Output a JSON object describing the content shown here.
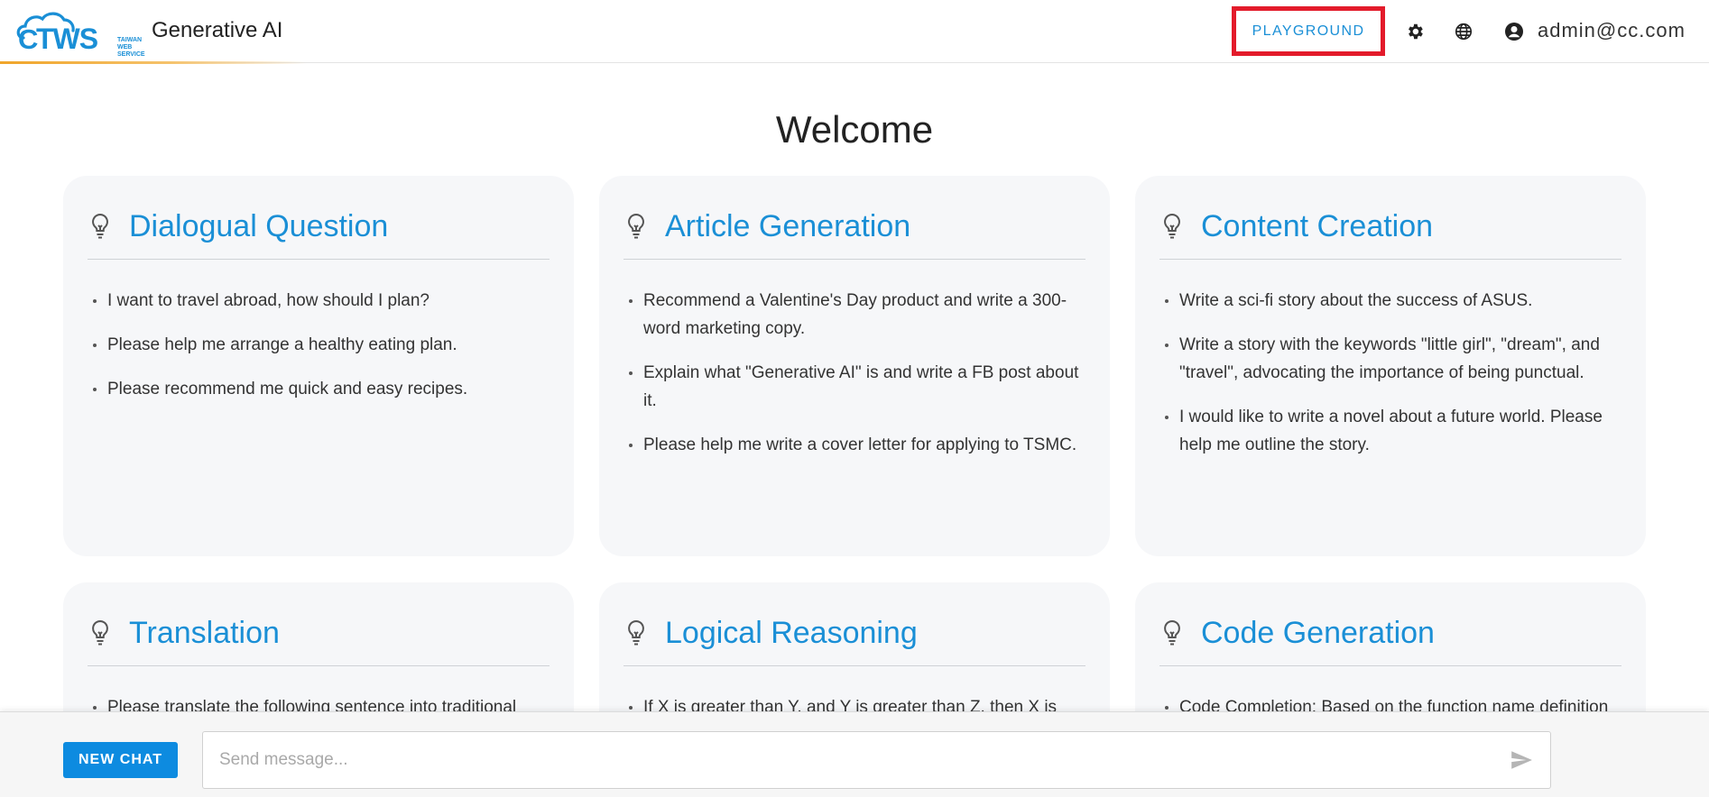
{
  "header": {
    "logo_text": "TWS",
    "logo_sub": [
      "TAIWAN",
      "WEB",
      "SERVICE"
    ],
    "app_title": "Generative AI",
    "playground_label": "PLAYGROUND",
    "settings_icon": "gear-icon",
    "language_icon": "globe-icon",
    "account_icon": "account-circle-icon",
    "user_email": "admin@cc.com"
  },
  "main": {
    "welcome": "Welcome",
    "cards": [
      {
        "title": "Dialogual Question",
        "icon": "lightbulb-icon",
        "items": [
          "I want to travel abroad, how should I plan?",
          "Please help me arrange a healthy eating plan.",
          "Please recommend me quick and easy recipes."
        ]
      },
      {
        "title": "Article Generation",
        "icon": "lightbulb-icon",
        "items": [
          "Recommend a Valentine's Day product and write a 300-word marketing copy.",
          "Explain what \"Generative AI\" is and write a FB post about it.",
          "Please help me write a cover letter for applying to TSMC."
        ]
      },
      {
        "title": "Content Creation",
        "icon": "lightbulb-icon",
        "items": [
          "Write a sci-fi story about the success of ASUS.",
          "Write a story with the keywords \"little girl\", \"dream\", and \"travel\", advocating the importance of being punctual.",
          "I would like to write a novel about a future world. Please help me outline the story."
        ]
      },
      {
        "title": "Translation",
        "icon": "lightbulb-icon",
        "items": [
          "Please translate the following sentence into traditional"
        ]
      },
      {
        "title": "Logical Reasoning",
        "icon": "lightbulb-icon",
        "items": [
          "If X is greater than Y, and Y is greater than Z, then X is"
        ]
      },
      {
        "title": "Code Generation",
        "icon": "lightbulb-icon",
        "items": [
          "Code Completion: Based on the function name definition"
        ]
      }
    ]
  },
  "footer": {
    "new_chat_label": "NEW CHAT",
    "message_placeholder": "Send message...",
    "send_icon": "send-icon"
  },
  "colors": {
    "accent": "#1a8fd6",
    "highlight_box": "#e31b2b",
    "new_chat_bg": "#0d8be0",
    "card_bg": "#f6f7f9"
  }
}
